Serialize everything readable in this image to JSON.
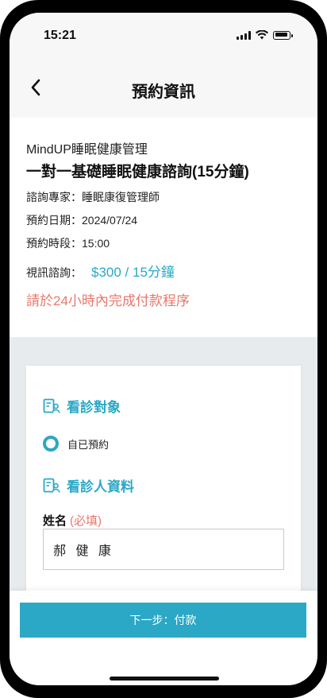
{
  "status_bar": {
    "time": "15:21"
  },
  "header": {
    "title": "預約資訊"
  },
  "info": {
    "provider": "MindUP睡眠健康管理",
    "service": "一對一基礎睡眠健康諮詢(15分鐘)",
    "expert": "諮詢專家：睡眠康復管理師",
    "date": "預約日期：2024/07/24",
    "time_slot": "預約時段：15:00",
    "video_label": "視訊諮詢：",
    "video_price": "$300 / 15分鐘",
    "notice": "請於24小時內完成付款程序"
  },
  "form": {
    "section_subject": "看診對象",
    "radio_self": "自已預約",
    "section_person": "看診人資料",
    "name_label": "姓名",
    "name_required": "(必填)",
    "name_value": "郝 健 康"
  },
  "footer": {
    "next_button": "下一步：付款"
  },
  "colors": {
    "accent": "#2aa8c5",
    "warning": "#e9776b"
  }
}
